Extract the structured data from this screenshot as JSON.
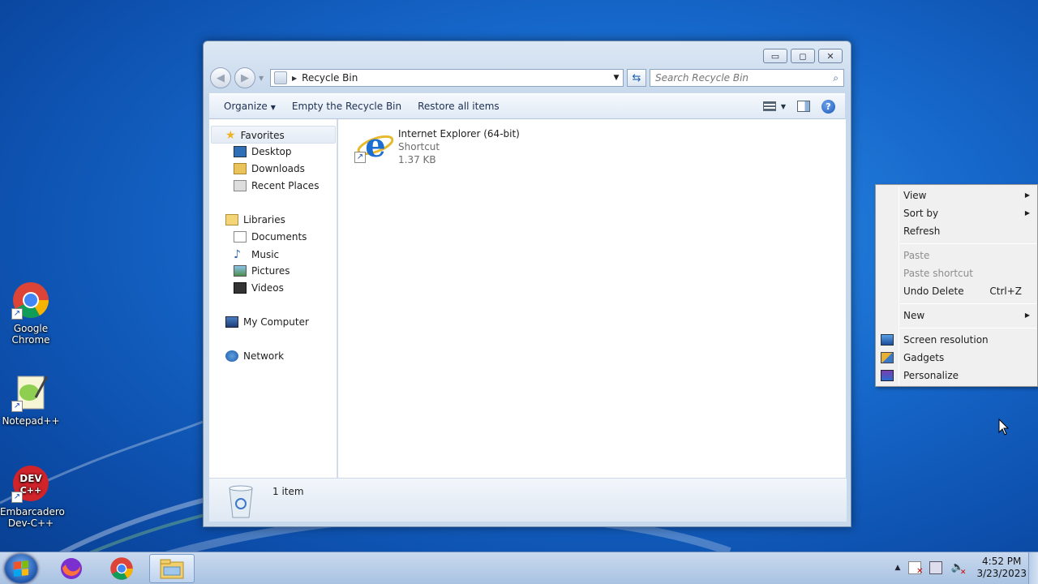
{
  "desktop": {
    "icons": [
      {
        "label": "Google Chrome"
      },
      {
        "label": "Notepad++"
      },
      {
        "label": "Embarcadero Dev-C++"
      }
    ]
  },
  "window": {
    "address_path": "Recycle Bin",
    "search_placeholder": "Search Recycle Bin",
    "commands": {
      "organize": "Organize",
      "empty": "Empty the Recycle Bin",
      "restore": "Restore all items"
    },
    "nav": {
      "favorites": "Favorites",
      "desktop": "Desktop",
      "downloads": "Downloads",
      "recent": "Recent Places",
      "libraries": "Libraries",
      "documents": "Documents",
      "music": "Music",
      "pictures": "Pictures",
      "videos": "Videos",
      "computer": "My Computer",
      "network": "Network"
    },
    "file": {
      "name": "Internet Explorer (64-bit)",
      "type": "Shortcut",
      "size": "1.37 KB"
    },
    "details_count": "1 item"
  },
  "context_menu": {
    "view": "View",
    "sort_by": "Sort by",
    "refresh": "Refresh",
    "paste": "Paste",
    "paste_shortcut": "Paste shortcut",
    "undo_delete": "Undo Delete",
    "undo_shortcut": "Ctrl+Z",
    "new": "New",
    "screen_resolution": "Screen resolution",
    "gadgets": "Gadgets",
    "personalize": "Personalize"
  },
  "taskbar": {
    "time": "4:52 PM",
    "date": "3/23/2023"
  },
  "colors": {
    "desktop_blue": "#1565c8",
    "window_frame": "#c7d8ec",
    "menu_bg": "#f0f0f0"
  }
}
